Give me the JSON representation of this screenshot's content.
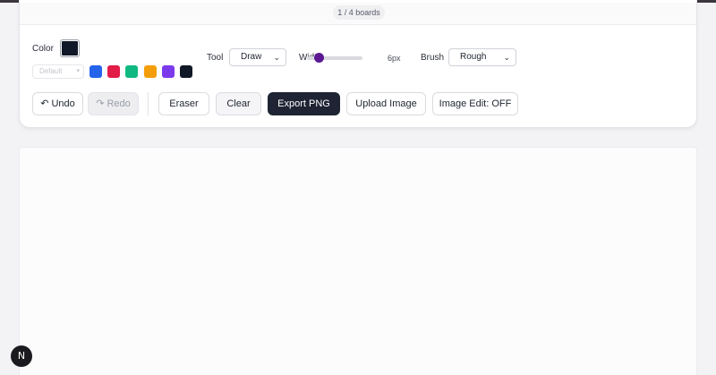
{
  "boards": {
    "indicator": "1 / 4 boards"
  },
  "toolbar": {
    "color_label": "Color",
    "current_color": "#111827",
    "palette_select_value": "Default",
    "swatches": [
      {
        "name": "blue",
        "color": "#2563eb"
      },
      {
        "name": "red",
        "color": "#e11d48"
      },
      {
        "name": "green",
        "color": "#10b981"
      },
      {
        "name": "amber",
        "color": "#f59e0b"
      },
      {
        "name": "purple",
        "color": "#7c3aed"
      },
      {
        "name": "black",
        "color": "#111827"
      }
    ],
    "tool_label": "Tool",
    "tool_value": "Draw",
    "width_label": "Width",
    "width_value": "6px",
    "brush_label": "Brush",
    "brush_value": "Rough",
    "undo_label": "Undo",
    "redo_label": "Redo",
    "eraser_label": "Eraser",
    "clear_label": "Clear",
    "export_label": "Export PNG",
    "upload_label": "Upload Image",
    "image_edit_label": "Image Edit: OFF"
  },
  "icons": {
    "undo": "undo-arrow-icon",
    "redo": "redo-arrow-icon",
    "chevron": "chevron-down-icon"
  },
  "badge": {
    "letter": "N"
  },
  "colors": {
    "accent": "#5b1892",
    "primary_button": "#1e2433"
  }
}
